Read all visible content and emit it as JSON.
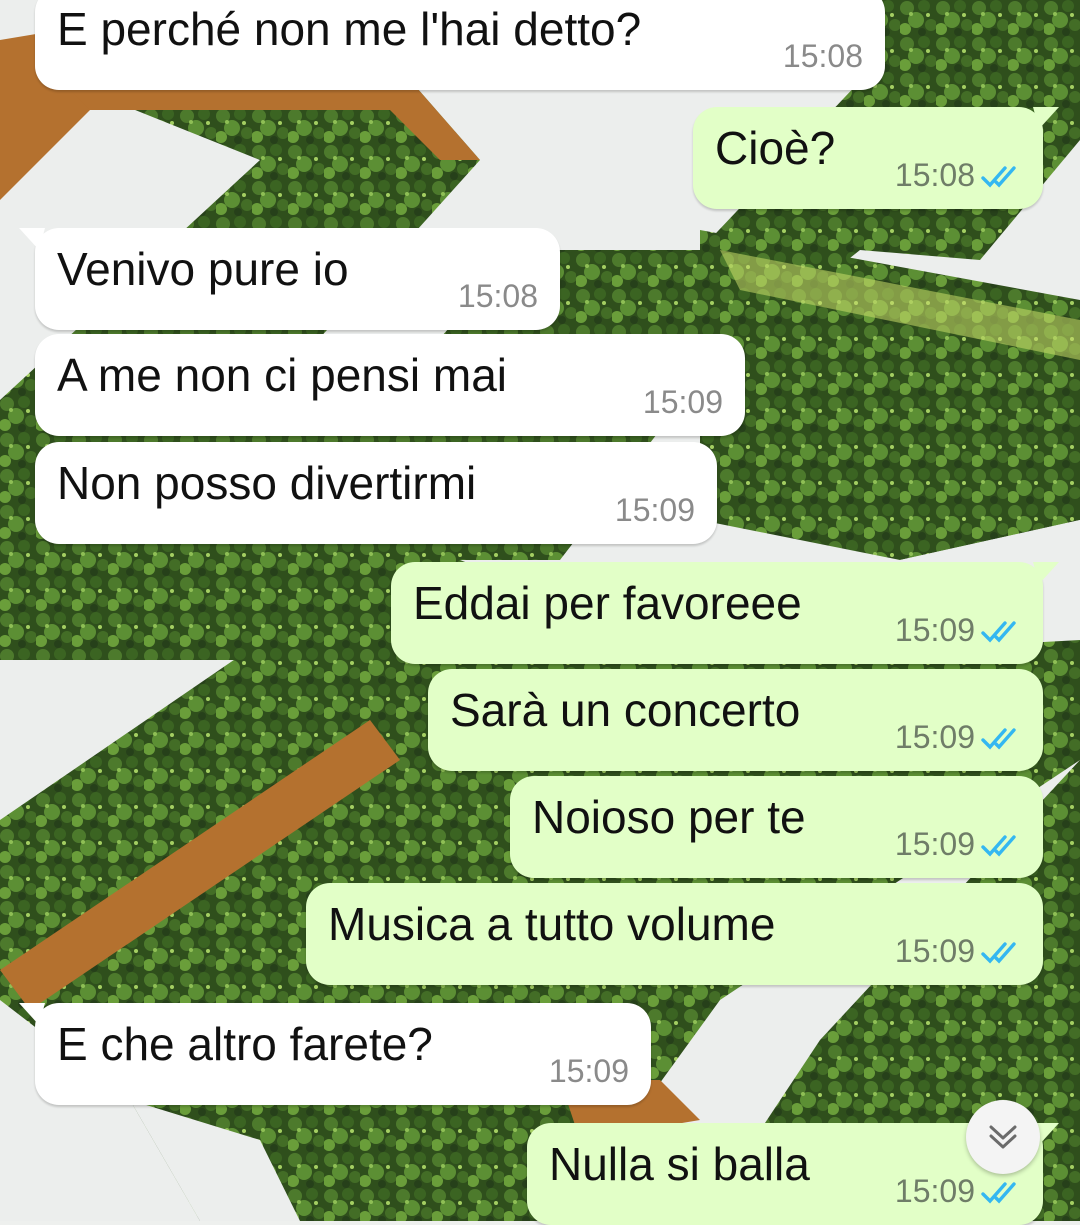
{
  "conversation": {
    "messages": [
      {
        "direction": "in",
        "text": "E perché non me l'hai detto?",
        "time": "15:08"
      },
      {
        "direction": "out",
        "text": "Cioè?",
        "time": "15:08",
        "status": "read-double-check-icon"
      },
      {
        "direction": "in",
        "text": "Venivo pure io",
        "time": "15:08"
      },
      {
        "direction": "in",
        "text": "A me non ci pensi mai",
        "time": "15:09"
      },
      {
        "direction": "in",
        "text": "Non posso divertirmi",
        "time": "15:09"
      },
      {
        "direction": "out",
        "text": "Eddai per favoreee",
        "time": "15:09",
        "status": "read-double-check-icon"
      },
      {
        "direction": "out",
        "text": "Sarà un concerto",
        "time": "15:09",
        "status": "read-double-check-icon"
      },
      {
        "direction": "out",
        "text": "Noioso per te",
        "time": "15:09",
        "status": "read-double-check-icon"
      },
      {
        "direction": "out",
        "text": "Musica a tutto volume",
        "time": "15:09",
        "status": "read-double-check-icon"
      },
      {
        "direction": "in",
        "text": "E che altro farete?",
        "time": "15:09"
      },
      {
        "direction": "out",
        "text": "Nulla si balla",
        "time": "15:09",
        "status": "read-double-check-icon"
      }
    ]
  },
  "scroll_to_bottom": {
    "icon": "double-chevron-down-icon"
  },
  "colors": {
    "incoming_bubble": "#ffffff",
    "outgoing_bubble": "#e2ffc7",
    "read_ticks": "#34b7f1",
    "time_text": "#8a8a8a"
  }
}
